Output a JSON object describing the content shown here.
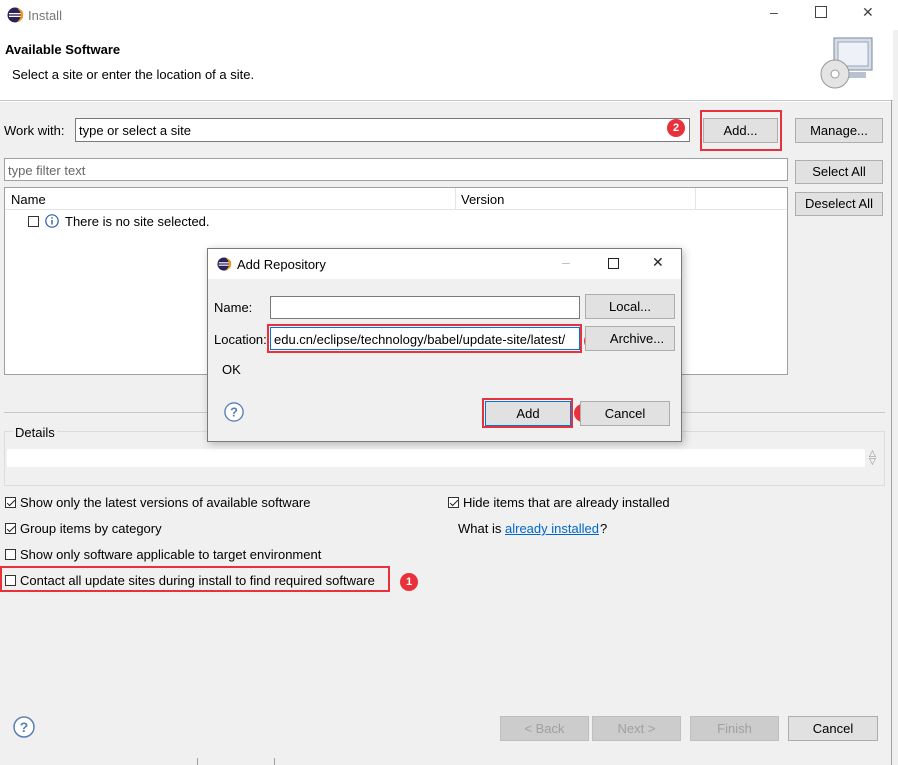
{
  "window": {
    "title": "Install"
  },
  "header": {
    "title": "Available Software",
    "subtitle": "Select a site or enter the location of a site."
  },
  "work_with": {
    "label": "Work with:",
    "value": "type or select a site",
    "add_label": "Add...",
    "manage_label": "Manage..."
  },
  "filter": {
    "placeholder": "type filter text",
    "select_all": "Select All",
    "deselect_all": "Deselect All"
  },
  "table": {
    "columns": [
      "Name",
      "Version"
    ],
    "empty_message": "There is no site selected."
  },
  "details": {
    "label": "Details"
  },
  "options": {
    "latest_versions": "Show only the latest versions of available software",
    "group_by_category": "Group items by category",
    "target_env": "Show only software applicable to target environment",
    "contact_sites": "Contact all update sites during install to find required software",
    "hide_installed": "Hide items that are already installed",
    "what_is_prefix": "What is ",
    "what_is_link": "already installed",
    "what_is_suffix": "?"
  },
  "footer": {
    "back": "< Back",
    "next": "Next >",
    "finish": "Finish",
    "cancel": "Cancel"
  },
  "dialog": {
    "title": "Add Repository",
    "name_label": "Name:",
    "name_value": "",
    "location_label": "Location:",
    "location_value": "edu.cn/eclipse/technology/babel/update-site/latest/",
    "local_button": "Local...",
    "archive_button": "Archive...",
    "status": "OK",
    "add_button": "Add",
    "cancel_button": "Cancel"
  },
  "annotations": [
    "1",
    "2",
    "3",
    "4"
  ],
  "colors": {
    "annotation": "#e8313a",
    "link": "#0066cc",
    "accent": "#0078d7"
  }
}
